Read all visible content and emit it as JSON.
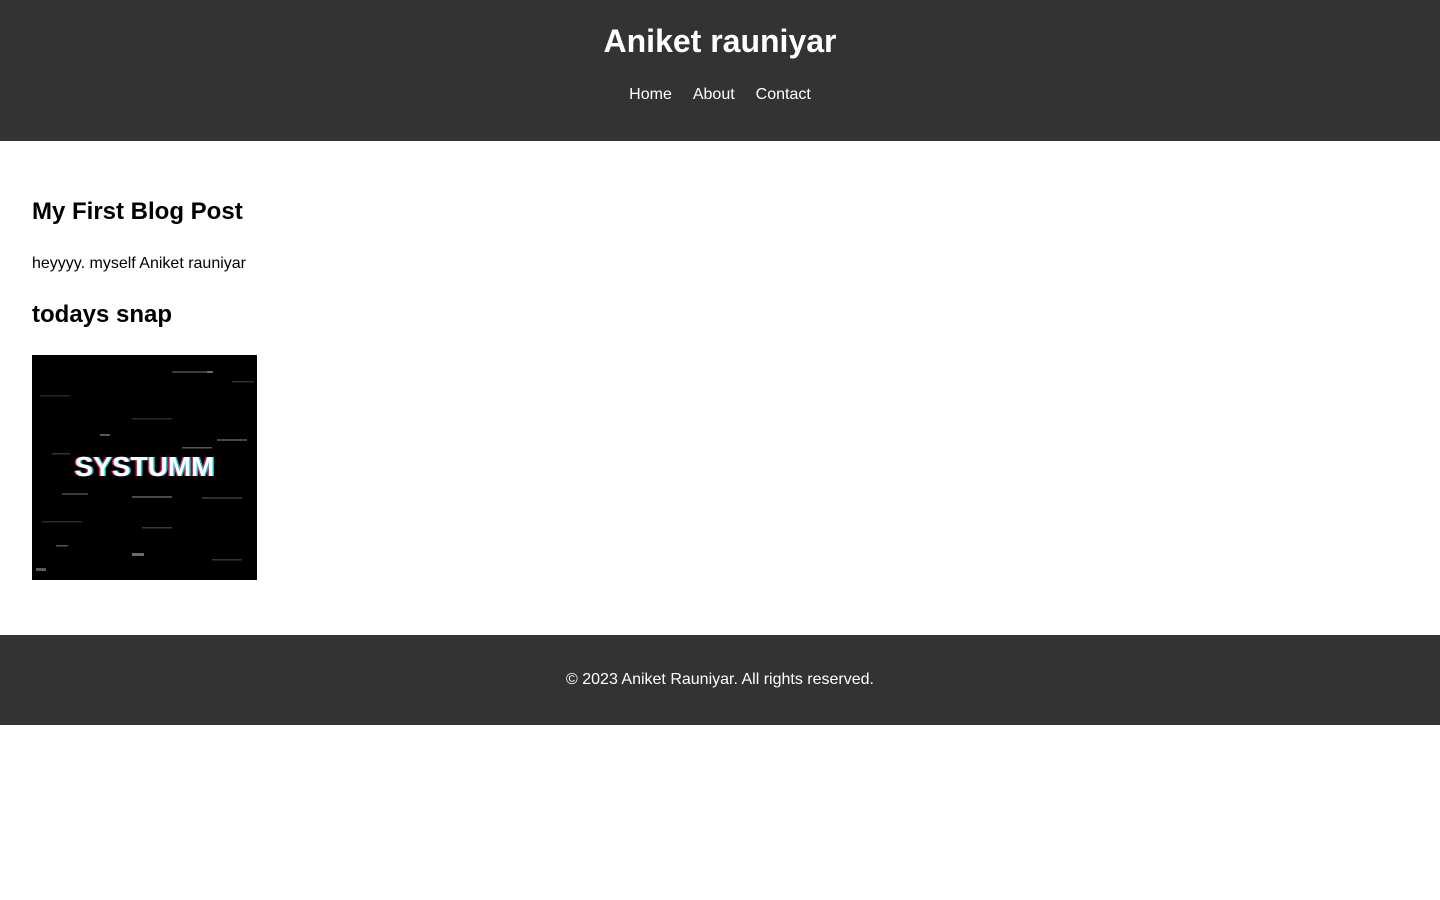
{
  "header": {
    "title": "Aniket rauniyar",
    "nav": [
      {
        "label": "Home"
      },
      {
        "label": "About"
      },
      {
        "label": "Contact"
      }
    ]
  },
  "post": {
    "title": "My First Blog Post",
    "text": "heyyyy. myself Aniket rauniyar",
    "snap_heading": "todays snap",
    "snap_image_text": "SYSTUMM"
  },
  "footer": {
    "text": "© 2023 Aniket Rauniyar. All rights reserved."
  },
  "colors": {
    "header_bg": "#333333",
    "footer_bg": "#333333",
    "text_light": "#ffffff",
    "text_dark": "#000000"
  }
}
